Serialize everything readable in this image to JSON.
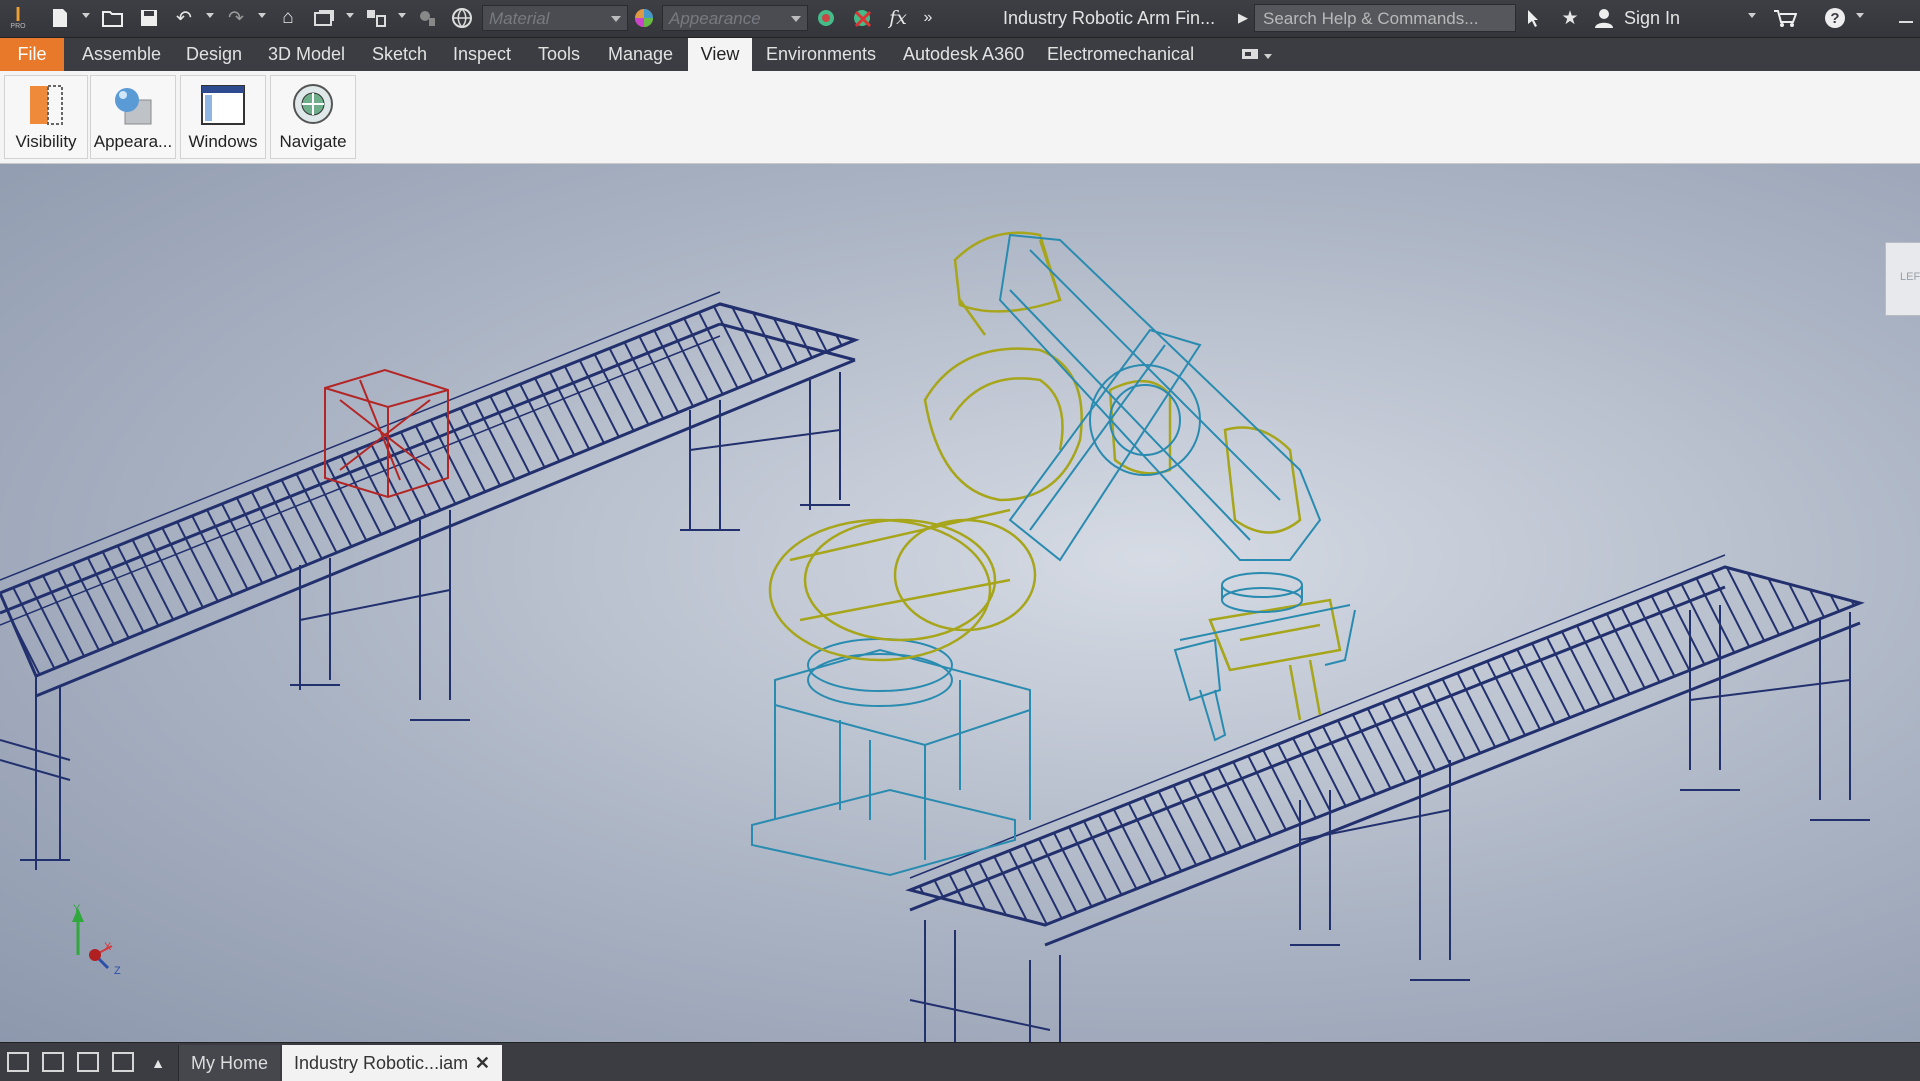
{
  "app": {
    "title": "Industry Robotic Arm Fin...",
    "search_placeholder": "Search Help & Commands...",
    "sign_in": "Sign In",
    "pro_badge": "PRO"
  },
  "qat": {
    "material_placeholder": "Material",
    "appearance_placeholder": "Appearance",
    "fx_label": "fx"
  },
  "tabs": [
    {
      "label": "File"
    },
    {
      "label": "Assemble"
    },
    {
      "label": "Design"
    },
    {
      "label": "3D Model"
    },
    {
      "label": "Sketch"
    },
    {
      "label": "Inspect"
    },
    {
      "label": "Tools"
    },
    {
      "label": "Manage"
    },
    {
      "label": "View",
      "active": true
    },
    {
      "label": "Environments"
    },
    {
      "label": "Autodesk A360"
    },
    {
      "label": "Electromechanical"
    }
  ],
  "ribbon": {
    "buttons": [
      {
        "label": "Visibility",
        "icon": "visibility-icon"
      },
      {
        "label": "Appeara...",
        "icon": "appearance-icon"
      },
      {
        "label": "Windows",
        "icon": "windows-icon"
      },
      {
        "label": "Navigate",
        "icon": "navigate-icon"
      }
    ]
  },
  "viewport": {
    "axis_labels": {
      "x": "X",
      "y": "Y",
      "z": "Z"
    },
    "viewcube_label": "LEFT"
  },
  "statusbar": {
    "home_tab": "My Home",
    "doc_tab": "Industry Robotic...iam",
    "close": "✕"
  },
  "colors": {
    "conveyor": "#22306e",
    "robot_yellow": "#a7a51a",
    "robot_cyan": "#2a8bb0",
    "box_red": "#b32626",
    "file_tab": "#e8782a"
  }
}
